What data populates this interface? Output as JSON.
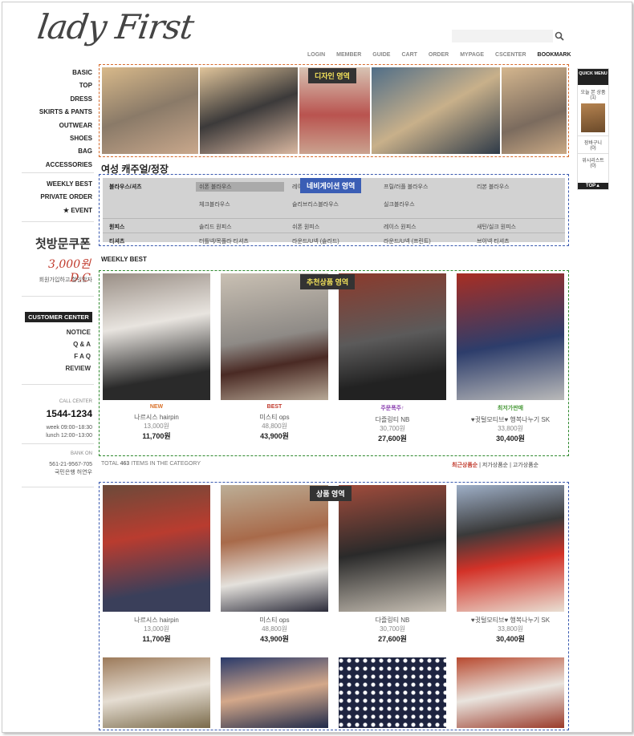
{
  "header": {
    "logo": "lady First",
    "search_placeholder": "",
    "top_menu": [
      "LOGIN",
      "MEMBER",
      "GUIDE",
      "CART",
      "ORDER",
      "MYPAGE",
      "CSCENTER",
      "BOOKMARK"
    ]
  },
  "sidebar": {
    "categories": [
      "BASIC",
      "TOP",
      "DRESS",
      "SKIRTS & PANTS",
      "OUTWEAR",
      "SHOES",
      "BAG",
      "ACCESSORIES"
    ],
    "specials": [
      "WEEKLY BEST",
      "PRIVATE ORDER",
      "EVENT"
    ],
    "coupon": {
      "line1": "첫방문쿠폰",
      "line2": "3,000원 D.C",
      "note": "회원가입하고 할인받자"
    },
    "customer_center": {
      "title": "CUSTOMER CENTER",
      "links": [
        "NOTICE",
        "Q & A",
        "F A Q",
        "REVIEW"
      ]
    },
    "call": {
      "label": "CALL CENTER",
      "number": "1544-1234",
      "week": "week 09:00~18:30",
      "lunch": "lunch 12:00~13:00"
    },
    "bank": {
      "label": "BANK ON",
      "account": "561-21-9567-705",
      "bank": "국민은행 허연우"
    }
  },
  "regions": {
    "design": "디자인 영역",
    "navigation": "네비게이션 영역",
    "recommend": "추천상품 영역",
    "products": "상품 영역"
  },
  "category_title": "여성 캐주얼/정장",
  "nav_table": [
    {
      "head": "블라우스/셔츠",
      "items": [
        "쉬폰 블라우스",
        "레이스 블라우스",
        "프릴/러플 블라우스",
        "리본 블라우스",
        "체크블라우스",
        "슬리브리스블라우스",
        "실크블라우스"
      ]
    },
    {
      "head": "원피스",
      "items": [
        "솔리드 원피스",
        "쉬폰 원피스",
        "레이스 원피스",
        "새틴/실크 원피스"
      ]
    },
    {
      "head": "티셔츠",
      "items": [
        "터틀넥/목폴라 티셔츠",
        "라운드/U넥 (솔리드)",
        "라운드/U넥 (프린트)",
        "브이넥 티셔츠"
      ]
    }
  ],
  "weekly_best_label": "WEEKLY BEST",
  "recommend": [
    {
      "badge": "NEW",
      "name": "나르시스 hairpin",
      "orig": "13,000원",
      "sale": "11,700원"
    },
    {
      "badge": "BEST",
      "name": "미스티 ops",
      "orig": "48,800원",
      "sale": "43,900원"
    },
    {
      "badge": "주문폭주↑",
      "name": "다즐링티 NB",
      "orig": "30,700원",
      "sale": "27,600원"
    },
    {
      "badge": "최저가판매",
      "name": "♥귓털모티브♥ 행복나누기 SK",
      "orig": "33,800원",
      "sale": "30,400원"
    }
  ],
  "total": {
    "prefix": "TOTAL",
    "count": "463",
    "suffix": "ITEMS IN THE CATEGORY"
  },
  "sort_options": [
    "최근상품순",
    "저가상품순",
    "고가상품순"
  ],
  "products": [
    {
      "name": "나르시스 hairpin",
      "orig": "13,000원",
      "sale": "11,700원"
    },
    {
      "name": "미스티 ops",
      "orig": "48,800원",
      "sale": "43,900원"
    },
    {
      "name": "다즐링티 NB",
      "orig": "30,700원",
      "sale": "27,600원"
    },
    {
      "name": "♥귓털모티브♥ 행복나누기 SK",
      "orig": "33,800원",
      "sale": "30,400원"
    }
  ],
  "quick_menu": {
    "title": "QUICK MENU",
    "recent": "오늘 본 상품",
    "recent_count": "(1)",
    "cart": "장바구니",
    "cart_count": "(0)",
    "wish": "위시리스트",
    "wish_count": "(0)",
    "top": "TOP▲"
  },
  "colors": {
    "design_border": "#d66a2a",
    "nav_border": "#3a5ab0",
    "recommend_border": "#2f8a2f",
    "label_bg": "#333333",
    "label_text": "#f3e25a",
    "sale_red": "#c0392b"
  }
}
